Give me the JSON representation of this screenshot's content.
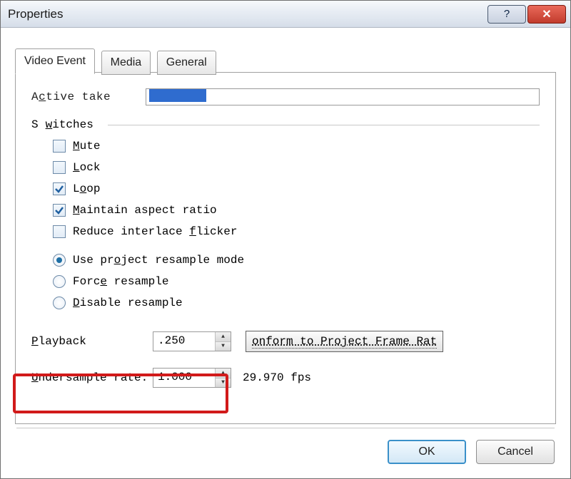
{
  "window": {
    "title": "Properties"
  },
  "tabs": [
    {
      "label": "Video Event"
    },
    {
      "label": "Media"
    },
    {
      "label": "General"
    }
  ],
  "active_take": {
    "label_pre": "A",
    "label_ul": "c",
    "label_post": "tive take",
    "value": ""
  },
  "switches": {
    "title": "S",
    "title_ul": "w",
    "title_post": "itches",
    "mute": {
      "label_ul": "M",
      "label_post": "ute",
      "checked": false
    },
    "lock": {
      "label_ul": "L",
      "label_post": "ock",
      "checked": false
    },
    "loop": {
      "label_pre": "L",
      "label_ul": "o",
      "label_post": "op",
      "checked": true
    },
    "aspect": {
      "label_ul": "M",
      "label_post": "aintain aspect ratio",
      "checked": true
    },
    "flicker": {
      "label_pre": "Reduce interlace ",
      "label_ul": "f",
      "label_post": "licker",
      "checked": false
    },
    "resample_radio": {
      "project": {
        "label_pre": "Use pr",
        "label_ul": "o",
        "label_post": "ject resample mode"
      },
      "force": {
        "label_pre": "Forc",
        "label_ul": "e",
        "label_post": " resample"
      },
      "disable": {
        "label_ul": "D",
        "label_post": "isable resample"
      },
      "selected": "project"
    }
  },
  "playback": {
    "label_ul": "P",
    "label_post": "layback",
    "value": ".250",
    "conform_btn": "onform to Project Frame Rat"
  },
  "undersample": {
    "label_ul": "U",
    "label_post": "ndersample rate:",
    "value": "1.000",
    "fps": "29.970 fps"
  },
  "buttons": {
    "ok": "OK",
    "cancel": "Cancel"
  }
}
